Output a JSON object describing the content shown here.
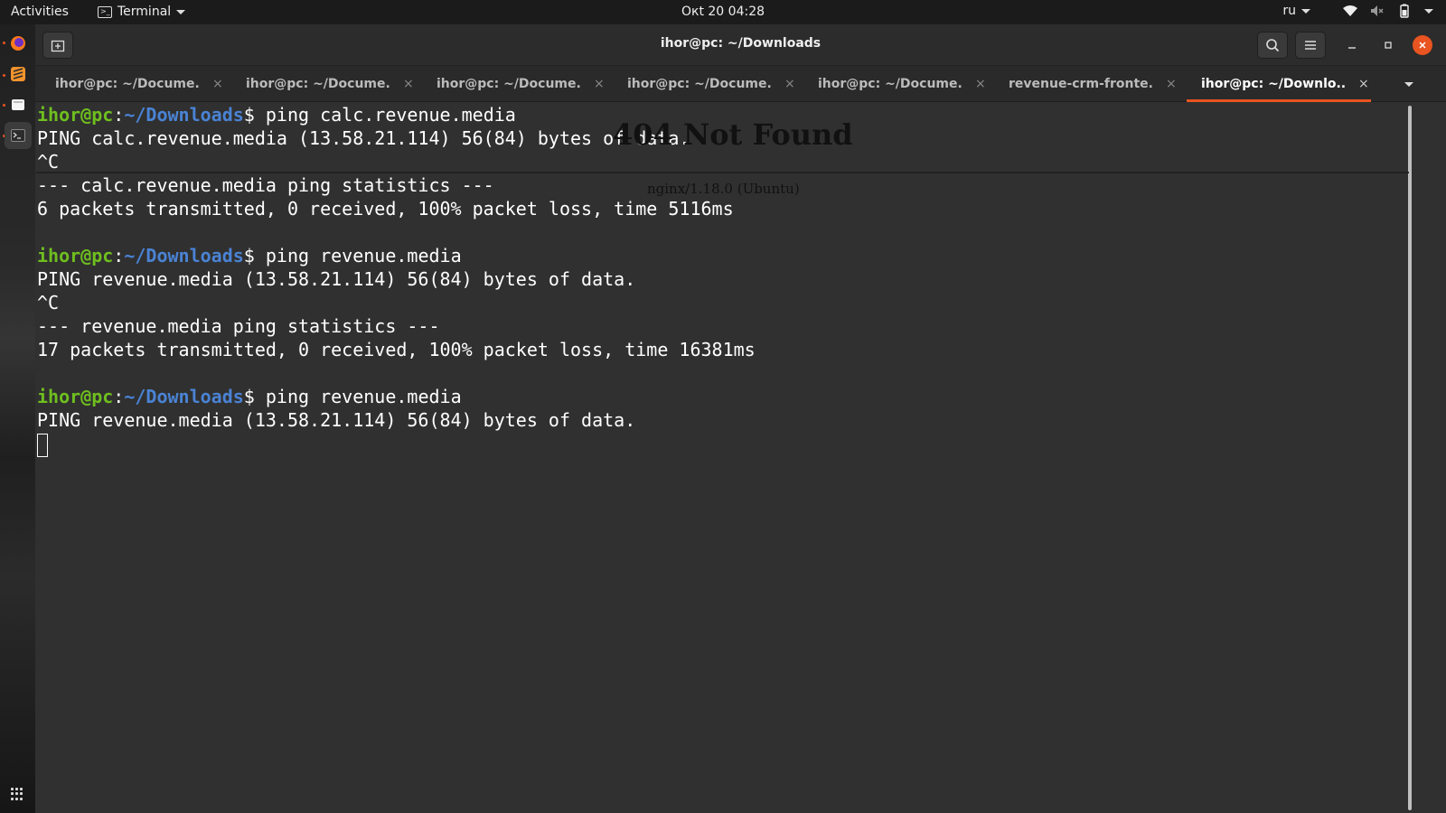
{
  "topbar": {
    "activities": "Activities",
    "app_menu": "Terminal",
    "clock": "Окt 20  04:28",
    "lang": "ru"
  },
  "window": {
    "title": "ihor@pc: ~/Downloads"
  },
  "tabs": [
    {
      "label": "ihor@pc: ~/Docume...",
      "close": "×"
    },
    {
      "label": "ihor@pc: ~/Docume...",
      "close": "×"
    },
    {
      "label": "ihor@pc: ~/Docume...",
      "close": "×"
    },
    {
      "label": "ihor@pc: ~/Docume...",
      "close": "×"
    },
    {
      "label": "ihor@pc: ~/Docume...",
      "close": "×"
    },
    {
      "label": "revenue-crm-fronte...",
      "close": "×"
    },
    {
      "label": "ihor@pc: ~/Downlo...",
      "close": "×",
      "active": true
    }
  ],
  "terminal": {
    "prompt_user": "ihor@pc",
    "prompt_sep": ":",
    "prompt_path": "~/Downloads",
    "prompt_end": "$ ",
    "cmd1": "ping calc.revenue.media",
    "out1": "PING calc.revenue.media (13.58.21.114) 56(84) bytes of data.",
    "out2": "^C",
    "out3": "--- calc.revenue.media ping statistics ---",
    "out4": "6 packets transmitted, 0 received, 100% packet loss, time 5116ms",
    "cmd2": "ping revenue.media",
    "out5": "PING revenue.media (13.58.21.114) 56(84) bytes of data.",
    "out6": "^C",
    "out7": "--- revenue.media ping statistics ---",
    "out8": "17 packets transmitted, 0 received, 100% packet loss, time 16381ms",
    "cmd3": "ping revenue.media",
    "out9": "PING revenue.media (13.58.21.114) 56(84) bytes of data."
  },
  "ghost_page": {
    "heading": "404 Not Found",
    "signature": "nginx/1.18.0 (Ubuntu)"
  },
  "colors": {
    "accent": "#e95420",
    "prompt_user": "#6fbf1f",
    "prompt_path": "#4a83d4",
    "terminal_bg": "#303030"
  },
  "icons": {
    "dock": [
      "firefox-icon",
      "sublime-text-icon",
      "files-icon",
      "terminal-icon",
      "app-grid-icon"
    ],
    "tray": [
      "wifi-icon",
      "volume-muted-icon",
      "battery-icon",
      "chevron-down-icon"
    ],
    "headerbar": [
      "new-tab-icon",
      "search-icon",
      "hamburger-menu-icon",
      "minimize-icon",
      "maximize-icon",
      "close-icon"
    ]
  }
}
